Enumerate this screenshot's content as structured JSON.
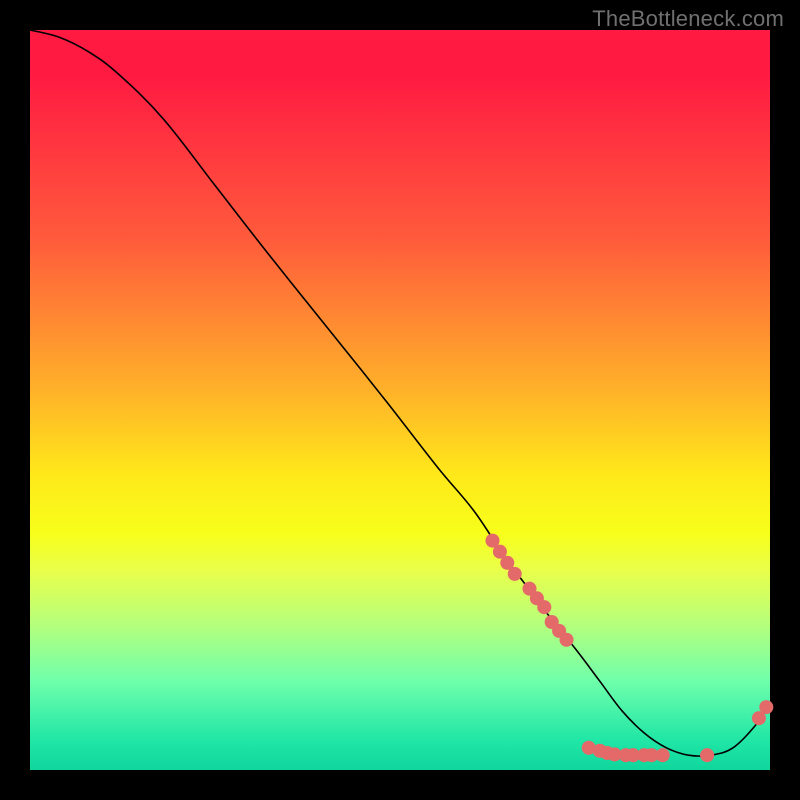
{
  "watermark": "TheBottleneck.com",
  "chart_data": {
    "type": "line",
    "title": "",
    "xlabel": "",
    "ylabel": "",
    "xlim": [
      0,
      100
    ],
    "ylim": [
      0,
      100
    ],
    "series": [
      {
        "name": "curve",
        "x": [
          0,
          4,
          8,
          12,
          18,
          25,
          32,
          40,
          48,
          55,
          60,
          64,
          67,
          70,
          74,
          77,
          80,
          83,
          86,
          89,
          92,
          95,
          98,
          100
        ],
        "values": [
          100,
          99,
          97,
          94,
          88,
          79,
          70,
          60,
          50,
          41,
          35,
          29,
          25,
          21,
          16,
          12,
          8,
          5,
          3,
          2,
          2,
          3,
          6,
          9
        ]
      }
    ],
    "markers": [
      {
        "x": 62.5,
        "y": 31.0
      },
      {
        "x": 63.5,
        "y": 29.5
      },
      {
        "x": 64.5,
        "y": 28.0
      },
      {
        "x": 65.5,
        "y": 26.5
      },
      {
        "x": 67.5,
        "y": 24.5
      },
      {
        "x": 68.5,
        "y": 23.2
      },
      {
        "x": 69.5,
        "y": 22.0
      },
      {
        "x": 70.5,
        "y": 20.0
      },
      {
        "x": 71.5,
        "y": 18.8
      },
      {
        "x": 72.5,
        "y": 17.6
      },
      {
        "x": 75.5,
        "y": 3.0
      },
      {
        "x": 77.0,
        "y": 2.6
      },
      {
        "x": 78.0,
        "y": 2.3
      },
      {
        "x": 79.0,
        "y": 2.1
      },
      {
        "x": 80.5,
        "y": 2.0
      },
      {
        "x": 81.5,
        "y": 2.0
      },
      {
        "x": 83.0,
        "y": 2.0
      },
      {
        "x": 84.0,
        "y": 2.0
      },
      {
        "x": 85.5,
        "y": 2.0
      },
      {
        "x": 91.5,
        "y": 2.0
      },
      {
        "x": 98.5,
        "y": 7.0
      },
      {
        "x": 99.5,
        "y": 8.5
      }
    ],
    "colors": {
      "gradient_top": "#ff1a42",
      "gradient_mid": "#ffe81a",
      "gradient_bottom": "#0fd69c",
      "curve": "#000000",
      "marker": "#e46a6a",
      "background": "#000000"
    }
  }
}
